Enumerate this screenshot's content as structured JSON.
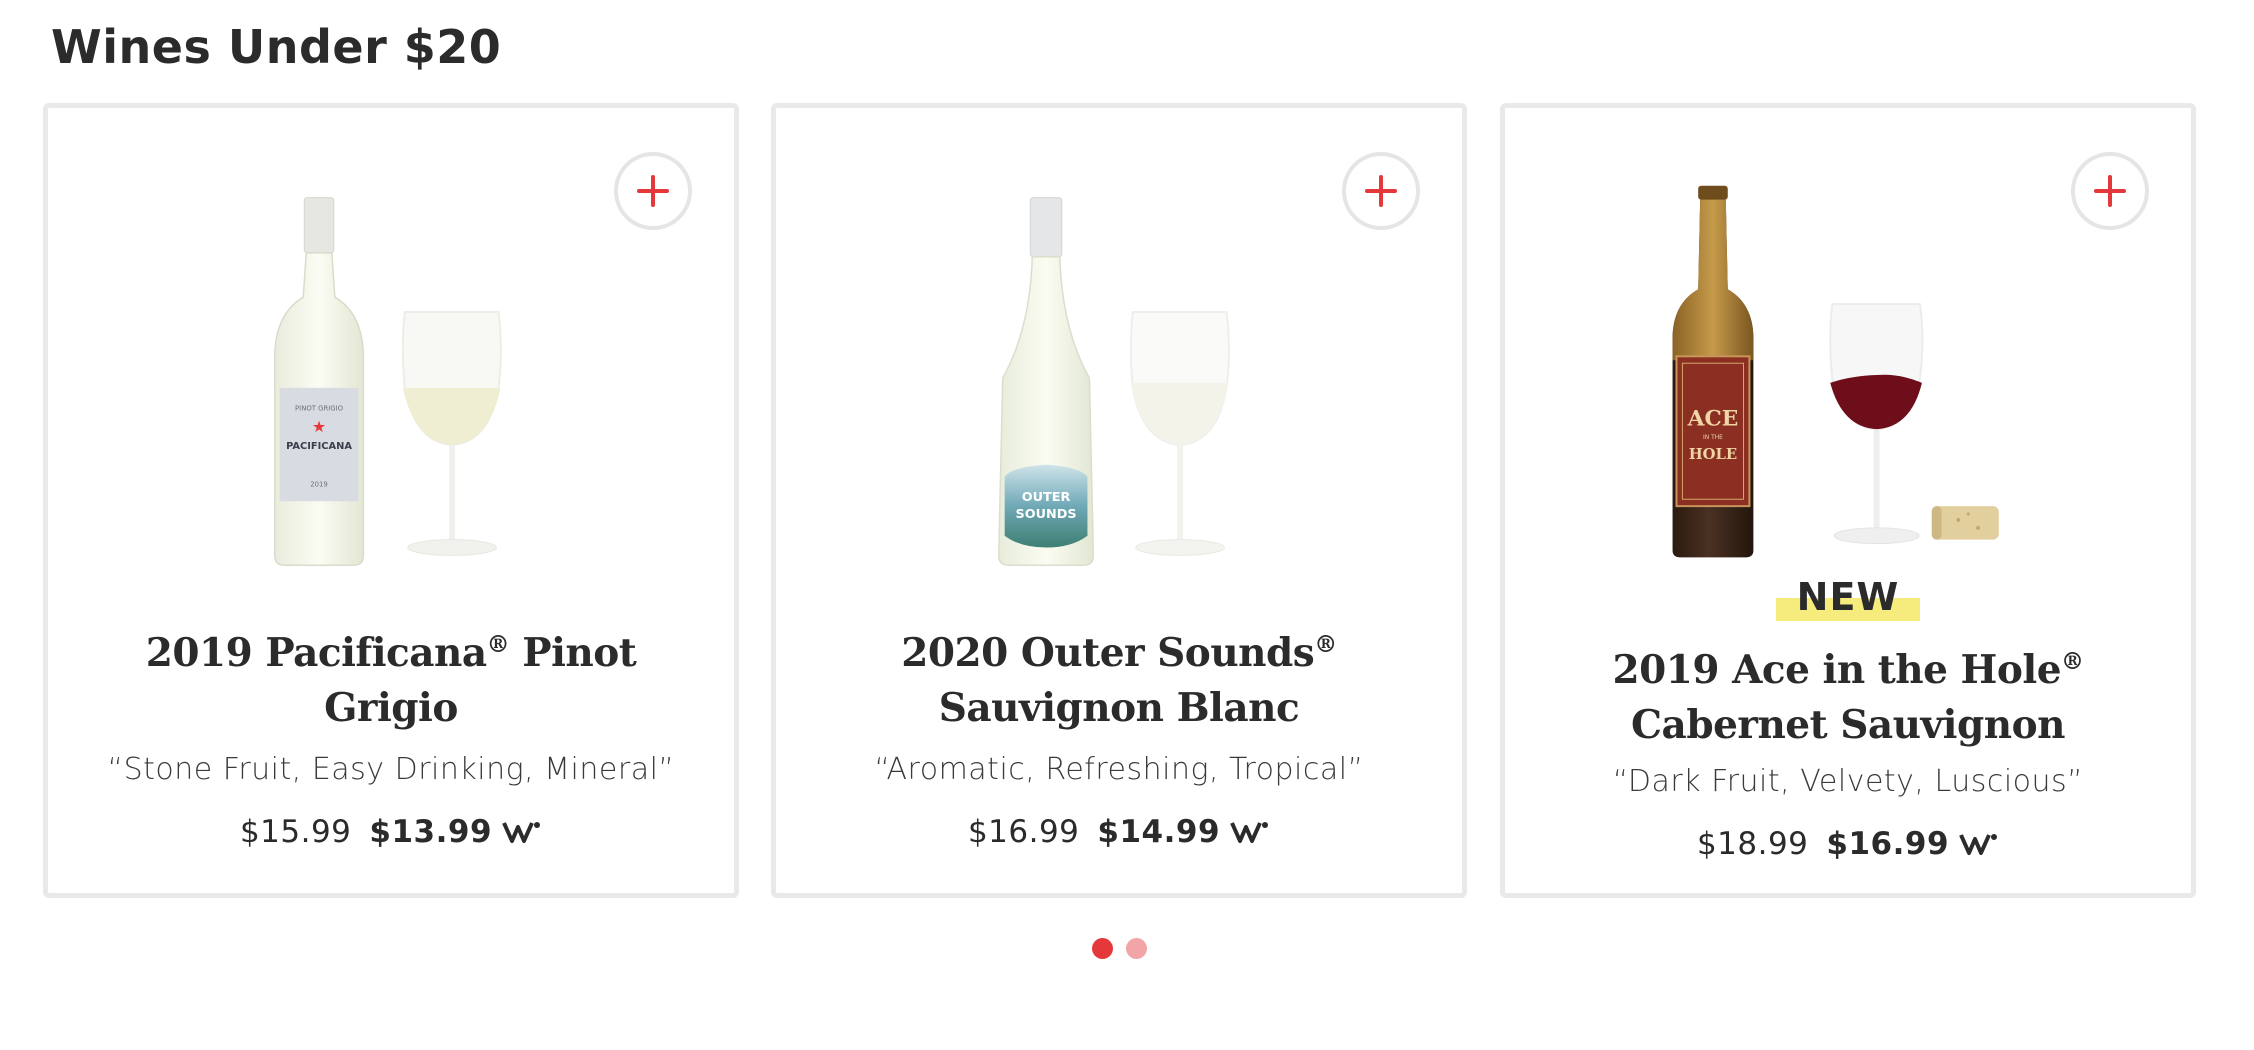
{
  "section": {
    "title": "Wines Under $20"
  },
  "products": [
    {
      "name": "2019 Pacificana",
      "name_suffix": " Pinot Grigio",
      "registered": "®",
      "tagline": "“Stone Fruit, Easy Drinking, Mineral”",
      "price_original": "$15.99",
      "price_member": "$13.99",
      "label_lines": [
        "PINOT GRIGIO",
        "PACIFICANA",
        "2019"
      ]
    },
    {
      "name": "2020 Outer Sounds",
      "name_suffix": " Sauvignon Blanc",
      "registered": "®",
      "tagline": "“Aromatic, Refreshing, Tropical”",
      "price_original": "$16.99",
      "price_member": "$14.99",
      "label_lines": [
        "OUTER",
        "SOUNDS"
      ]
    },
    {
      "badge": "NEW",
      "name": "2019 Ace in the Hole",
      "name_suffix": " Cabernet Sauvignon",
      "registered": "®",
      "tagline": "“Dark Fruit, Velvety, Luscious”",
      "price_original": "$18.99",
      "price_member": "$16.99",
      "label_lines": [
        "ACE",
        "IN THE",
        "HOLE"
      ]
    }
  ],
  "icons": {
    "add": "plus-icon",
    "member": "winc-member-icon"
  },
  "colors": {
    "accent": "#e5383b",
    "badge_highlight": "#f6ec7e",
    "card_border": "#e9e9ea",
    "dot_inactive": "#f2a5a7"
  },
  "pagination": {
    "pages": 2,
    "current": 1
  }
}
